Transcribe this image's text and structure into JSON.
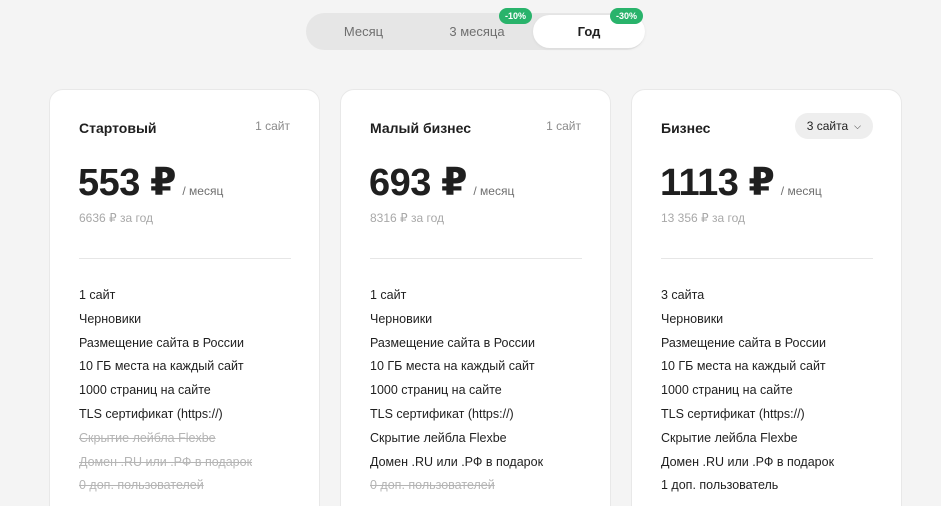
{
  "period_switcher": {
    "options": [
      {
        "label": "Месяц",
        "badge": ""
      },
      {
        "label": "3 месяца",
        "badge": "-10%"
      },
      {
        "label": "Год",
        "badge": "-30%"
      }
    ],
    "selected": "Год"
  },
  "colors": {
    "accent_badge": "#29b36b",
    "page_bg": "#f4f4f4",
    "disabled_text": "#b5b5b5"
  },
  "plans": [
    {
      "name": "Стартовый",
      "sites": "1 сайт",
      "price": "553 ₽",
      "per": "/ месяц",
      "yearly": "6636 ₽ за год",
      "features": [
        {
          "label": "1 сайт",
          "enabled": true
        },
        {
          "label": "Черновики",
          "enabled": true
        },
        {
          "label": "Размещение сайта в России",
          "enabled": true
        },
        {
          "label": "10 ГБ места на каждый сайт",
          "enabled": true
        },
        {
          "label": "1000 страниц на сайте",
          "enabled": true
        },
        {
          "label": "TLS сертификат (https://)",
          "enabled": true
        },
        {
          "label": "Скрытие лейбла Flexbe",
          "enabled": false
        },
        {
          "label": "Домен .RU или .РФ в подарок",
          "enabled": false
        },
        {
          "label": "0 доп. пользователей",
          "enabled": false
        }
      ]
    },
    {
      "name": "Малый бизнес",
      "sites": "1 сайт",
      "price": "693 ₽",
      "per": "/ месяц",
      "yearly": "8316 ₽ за год",
      "features": [
        {
          "label": "1 сайт",
          "enabled": true
        },
        {
          "label": "Черновики",
          "enabled": true
        },
        {
          "label": "Размещение сайта в России",
          "enabled": true
        },
        {
          "label": "10 ГБ места на каждый сайт",
          "enabled": true
        },
        {
          "label": "1000 страниц на сайте",
          "enabled": true
        },
        {
          "label": "TLS сертификат (https://)",
          "enabled": true
        },
        {
          "label": "Скрытие лейбла Flexbe",
          "enabled": true
        },
        {
          "label": "Домен .RU или .РФ в подарок",
          "enabled": true
        },
        {
          "label": "0 доп. пользователей",
          "enabled": false
        }
      ]
    },
    {
      "name": "Бизнес",
      "sites": "3 сайта",
      "price": "1113 ₽",
      "per": "/ месяц",
      "yearly": "13 356 ₽ за год",
      "features": [
        {
          "label": "3 сайта",
          "enabled": true
        },
        {
          "label": "Черновики",
          "enabled": true
        },
        {
          "label": "Размещение сайта в России",
          "enabled": true
        },
        {
          "label": "10 ГБ места на каждый сайт",
          "enabled": true
        },
        {
          "label": "1000 страниц на сайте",
          "enabled": true
        },
        {
          "label": "TLS сертификат (https://)",
          "enabled": true
        },
        {
          "label": "Скрытие лейбла Flexbe",
          "enabled": true
        },
        {
          "label": "Домен .RU или .РФ в подарок",
          "enabled": true
        },
        {
          "label": "1 доп. пользователь",
          "enabled": true
        }
      ]
    }
  ]
}
